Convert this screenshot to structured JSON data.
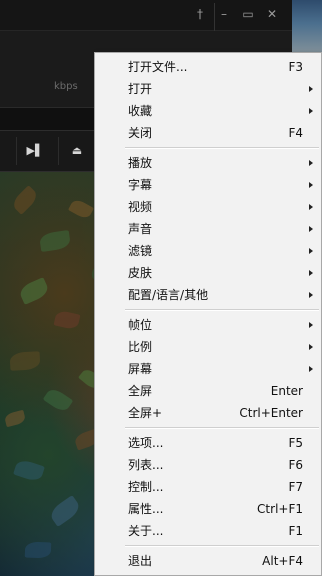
{
  "player": {
    "bitrate_unit": "kbps",
    "window_buttons": [
      {
        "name": "pin-icon",
        "glyph": "†"
      },
      {
        "name": "minimize-icon",
        "glyph": "–"
      },
      {
        "name": "maximize-icon",
        "glyph": "▭"
      },
      {
        "name": "close-icon",
        "glyph": "✕"
      }
    ],
    "control_buttons": [
      {
        "name": "next-track-icon",
        "glyph": "▶▌"
      },
      {
        "name": "eject-icon",
        "glyph": "⏏"
      }
    ]
  },
  "menu": {
    "groups": [
      [
        {
          "label": "打开文件...",
          "shortcut": "F3",
          "submenu": false
        },
        {
          "label": "打开",
          "shortcut": "",
          "submenu": true
        },
        {
          "label": "收藏",
          "shortcut": "",
          "submenu": true
        },
        {
          "label": "关闭",
          "shortcut": "F4",
          "submenu": false
        }
      ],
      [
        {
          "label": "播放",
          "shortcut": "",
          "submenu": true
        },
        {
          "label": "字幕",
          "shortcut": "",
          "submenu": true
        },
        {
          "label": "视频",
          "shortcut": "",
          "submenu": true
        },
        {
          "label": "声音",
          "shortcut": "",
          "submenu": true
        },
        {
          "label": "滤镜",
          "shortcut": "",
          "submenu": true
        },
        {
          "label": "皮肤",
          "shortcut": "",
          "submenu": true
        },
        {
          "label": "配置/语言/其他",
          "shortcut": "",
          "submenu": true
        }
      ],
      [
        {
          "label": "帧位",
          "shortcut": "",
          "submenu": true
        },
        {
          "label": "比例",
          "shortcut": "",
          "submenu": true
        },
        {
          "label": "屏幕",
          "shortcut": "",
          "submenu": true
        },
        {
          "label": "全屏",
          "shortcut": "Enter",
          "submenu": false
        },
        {
          "label": "全屏+",
          "shortcut": "Ctrl+Enter",
          "submenu": false
        }
      ],
      [
        {
          "label": "选项...",
          "shortcut": "F5",
          "submenu": false
        },
        {
          "label": "列表...",
          "shortcut": "F6",
          "submenu": false
        },
        {
          "label": "控制...",
          "shortcut": "F7",
          "submenu": false
        },
        {
          "label": "属性...",
          "shortcut": "Ctrl+F1",
          "submenu": false
        },
        {
          "label": "关于...",
          "shortcut": "F1",
          "submenu": false
        }
      ],
      [
        {
          "label": "退出",
          "shortcut": "Alt+F4",
          "submenu": false
        }
      ]
    ]
  }
}
